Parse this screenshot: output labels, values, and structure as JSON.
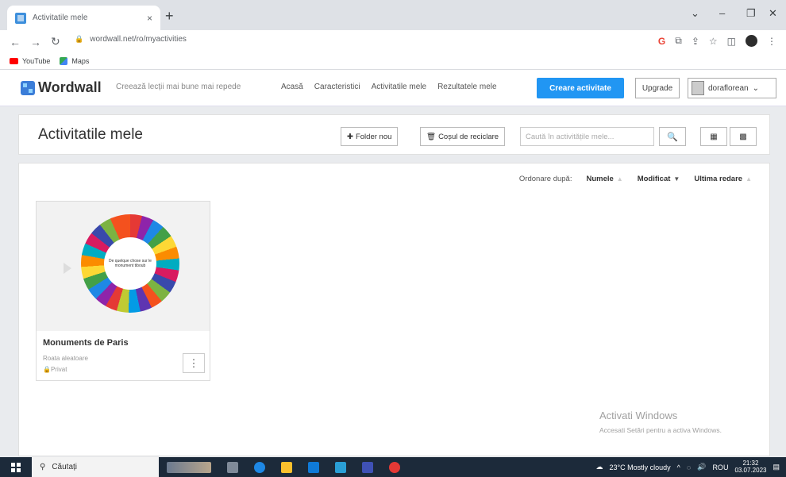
{
  "browser": {
    "tab_title": "Activitatile mele",
    "tab_close": "×",
    "new_tab": "+",
    "url": "wordwall.net/ro/myactivities",
    "bookmarks": [
      "YouTube",
      "Maps"
    ]
  },
  "header": {
    "logo": "Wordwall",
    "tagline": "Creează lecții mai bune mai repede",
    "nav": [
      "Acasă",
      "Caracteristici",
      "Activitatile mele",
      "Rezultatele mele"
    ],
    "create_label": "Creare activitate",
    "upgrade_label": "Upgrade",
    "username": "doraflorean"
  },
  "toolbar": {
    "page_title": "Activitatile mele",
    "new_folder": "Folder nou",
    "recycle_bin": "Coșul de reciclare",
    "search_placeholder": "Caută în activitățile mele..."
  },
  "sort": {
    "label": "Ordonare după:",
    "name": "Numele",
    "modified": "Modificat",
    "last_played": "Ultima redare"
  },
  "activities": [
    {
      "title": "Monuments de Paris",
      "type": "Roata aleatoare",
      "privacy": "Privat",
      "wheel_center": "De quelque chose sur le monument tiboub"
    }
  ],
  "watermark": {
    "title": "Activati Windows",
    "subtitle": "Accesati Setări pentru a activa Windows."
  },
  "taskbar": {
    "search": "Căutați",
    "weather": "23°C  Mostly cloudy",
    "lang": "ROU",
    "time": "21:32",
    "date": "03.07.2023"
  },
  "colors": {
    "accent": "#2196f3",
    "taskbar": "#1c2a3a"
  }
}
